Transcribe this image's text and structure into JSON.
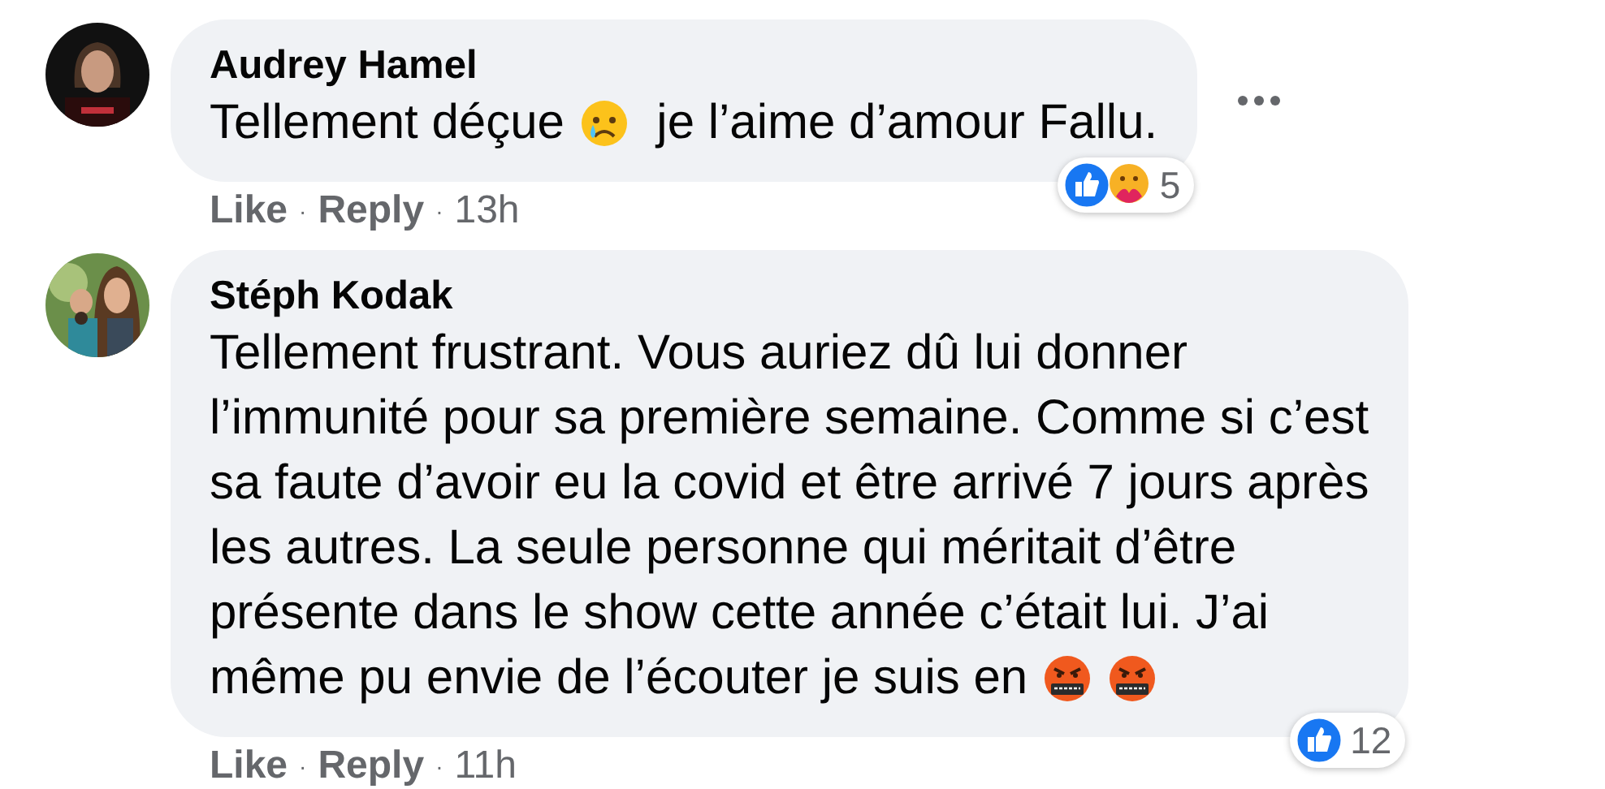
{
  "comments": [
    {
      "author": "Audrey Hamel",
      "avatar": {
        "kind": "picture"
      },
      "body": [
        [
          {
            "kind": "text",
            "text": "Tellement déçue "
          },
          {
            "kind": "sad-emoji"
          },
          {
            "kind": "text",
            "text": " je l’aime d’amour Fallu."
          }
        ]
      ],
      "reactions": {
        "icons": [
          {
            "kind": "like"
          },
          {
            "kind": "care"
          }
        ],
        "count": "5"
      },
      "meta": [
        {
          "kind": "link",
          "text": "Like"
        },
        {
          "kind": "separator",
          "text": "·"
        },
        {
          "kind": "link",
          "text": "Reply"
        },
        {
          "kind": "separator",
          "text": "·"
        },
        {
          "kind": "time",
          "text": "13h"
        }
      ],
      "menu": true
    },
    {
      "author": "Stéph Kodak",
      "avatar": {
        "kind": "picture"
      },
      "body": [
        [
          {
            "kind": "text",
            "text": "Tellement frustrant. Vous auriez dû lui donner"
          }
        ],
        [
          {
            "kind": "text",
            "text": "l’immunité pour sa première semaine. Comme si c’est"
          }
        ],
        [
          {
            "kind": "text",
            "text": "sa faute d’avoir eu la covid et être arrivé 7 jours après"
          }
        ],
        [
          {
            "kind": "text",
            "text": "les autres. La seule personne qui méritait d’être"
          }
        ],
        [
          {
            "kind": "text",
            "text": "présente dans le show cette année c’était lui. J’ai"
          }
        ],
        [
          {
            "kind": "text",
            "text": "même pu envie de l’écouter je suis en "
          },
          {
            "kind": "cursing-emoji"
          },
          {
            "kind": "cursing-emoji"
          }
        ]
      ],
      "reactions": {
        "icons": [
          {
            "kind": "like"
          }
        ],
        "count": "12"
      },
      "meta": [
        {
          "kind": "link",
          "text": "Like"
        },
        {
          "kind": "separator",
          "text": "·"
        },
        {
          "kind": "link",
          "text": "Reply"
        },
        {
          "kind": "separator",
          "text": "·"
        },
        {
          "kind": "time",
          "text": "11h"
        }
      ],
      "menu": false
    }
  ]
}
